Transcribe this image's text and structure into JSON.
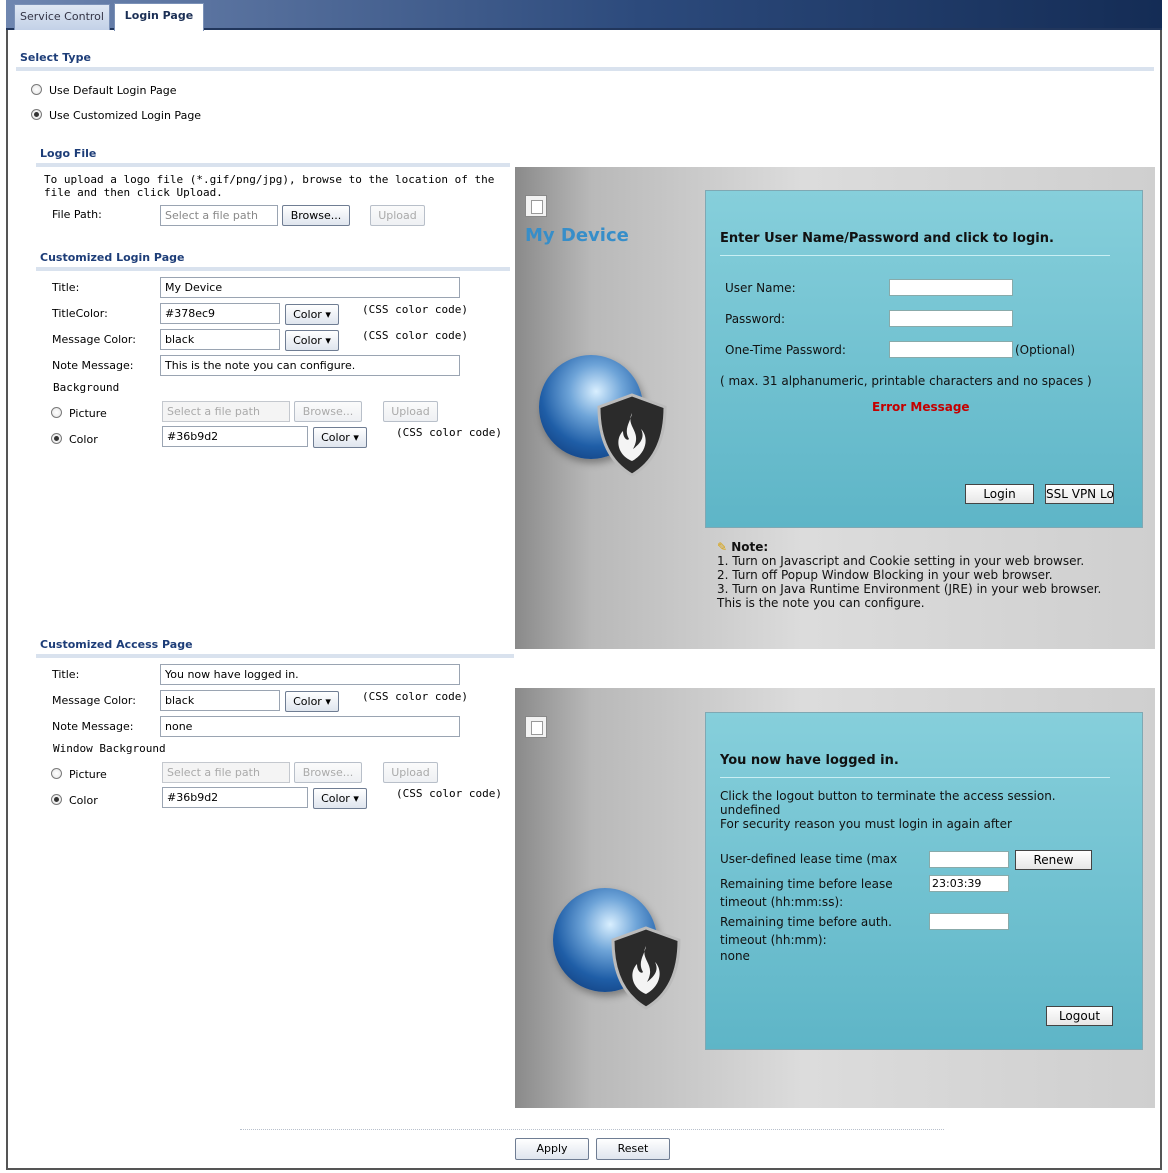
{
  "tabs": [
    "Service Control",
    "Login Page"
  ],
  "select_type": {
    "title": "Select Type",
    "options": [
      "Use Default Login Page",
      "Use Customized Login Page"
    ],
    "selected": 1
  },
  "logo_file": {
    "title": "Logo File",
    "description": "To upload a logo file (*.gif/png/jpg), browse to the location of the file and then click Upload.",
    "file_path_label": "File Path:",
    "file_path_placeholder": "Select a file path",
    "browse_label": "Browse...",
    "upload_label": "Upload"
  },
  "login_page": {
    "title": "Customized Login Page",
    "title_label": "Title:",
    "title_value": "My Device",
    "title_color_label": "TitleColor:",
    "title_color_value": "#378ec9",
    "message_color_label": "Message Color:",
    "message_color_value": "black",
    "note_label": "Note Message:",
    "note_value": "This is the note you can configure.",
    "background_label": "Background",
    "picture_label": "Picture",
    "picture_placeholder": "Select a file path",
    "color_label": "Color",
    "bg_color_value": "#36b9d2",
    "color_button": "Color",
    "css_hint": "(CSS color code)",
    "browse_label": "Browse...",
    "upload_label": "Upload"
  },
  "login_preview": {
    "device_title": "My Device",
    "title_color": "#378ec9",
    "heading": "Enter User Name/Password and click to login.",
    "user_label": "User Name:",
    "password_label": "Password:",
    "otp_label": "One-Time Password:",
    "optional": "(Optional)",
    "hint": "( max. 31 alphanumeric, printable characters and no spaces )",
    "error": "Error Message",
    "login_button": "Login",
    "ssl_button": "SSL VPN Lo",
    "note_title": "Note:",
    "notes": [
      "1. Turn on Javascript and Cookie setting in your web browser.",
      "2. Turn off Popup Window Blocking in your web browser.",
      "3. Turn on Java Runtime Environment (JRE) in your web browser.",
      "This is the note you can configure."
    ]
  },
  "access_page": {
    "title": "Customized Access Page",
    "title_label": "Title:",
    "title_value": "You now have logged in.",
    "message_color_label": "Message Color:",
    "message_color_value": "black",
    "note_label": "Note Message:",
    "note_value": "none",
    "background_label": "Window Background",
    "picture_label": "Picture",
    "picture_placeholder": "Select a file path",
    "color_label": "Color",
    "bg_color_value": "#36b9d2",
    "color_button": "Color",
    "css_hint": "(CSS color code)",
    "browse_label": "Browse...",
    "upload_label": "Upload"
  },
  "access_preview": {
    "heading": "You now have logged in.",
    "line1": "Click the logout button to terminate the access session.",
    "line2": "undefined",
    "line3": "For security reason you must login in again after",
    "lease_label": "User-defined lease time (max",
    "renew_button": "Renew",
    "remaining_lease_label1": "Remaining time before lease",
    "remaining_lease_label2": "timeout (hh:mm:ss):",
    "remaining_lease_value": "23:03:39",
    "remaining_auth_label1": "Remaining time before auth.",
    "remaining_auth_label2": "timeout (hh:mm):",
    "remaining_auth_value": "none",
    "logout_button": "Logout"
  },
  "footer": {
    "apply": "Apply",
    "reset": "Reset"
  }
}
